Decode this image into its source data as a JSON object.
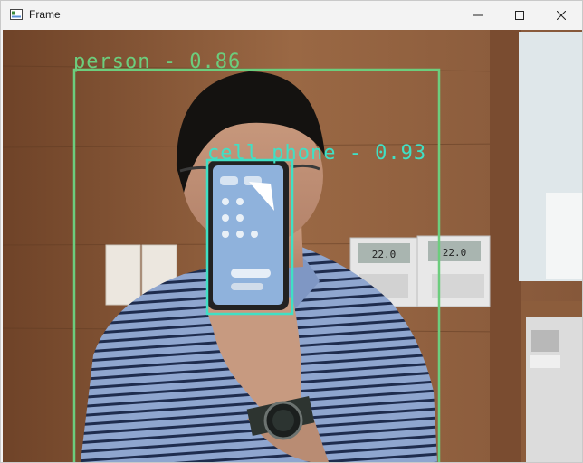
{
  "window": {
    "title": "Frame",
    "controls": {
      "minimize": "minimize-icon",
      "maximize": "maximize-icon",
      "close": "close-icon"
    }
  },
  "detections": [
    {
      "label": "person - 0.86",
      "color": "#6ccd7d"
    },
    {
      "label": "cell phone - 0.93",
      "color": "#3fe0c5"
    }
  ],
  "thermostats": [
    {
      "display": "22.0"
    },
    {
      "display": "22.0"
    }
  ],
  "colors": {
    "person_box": "#6ccd7d",
    "phone_box": "#3fe0c5",
    "wall": "#8a5a38"
  }
}
